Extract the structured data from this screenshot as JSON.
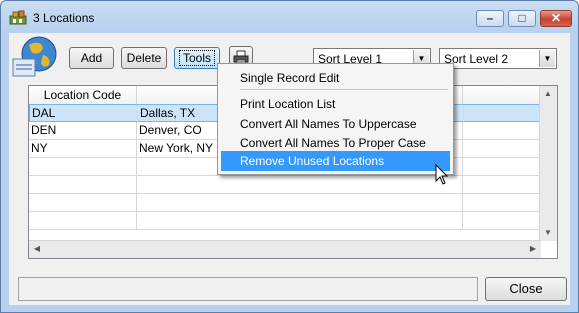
{
  "window": {
    "title": "3 Locations",
    "caption_buttons": {
      "minimize": "–",
      "maximize": "□",
      "close": "✕"
    }
  },
  "toolbar": {
    "add_label": "Add",
    "delete_label": "Delete",
    "tools_label": "Tools",
    "print_icon": "printer-icon",
    "sort_level_1": "Sort Level 1",
    "sort_level_2": "Sort Level 2"
  },
  "grid": {
    "columns": [
      "Location Code",
      "",
      ""
    ],
    "rows": [
      {
        "code": "DAL",
        "name": "Dallas, TX",
        "selected": true
      },
      {
        "code": "DEN",
        "name": "Denver, CO",
        "selected": false
      },
      {
        "code": "NY",
        "name": "New York, NY",
        "selected": false
      }
    ]
  },
  "tools_menu": {
    "items": [
      "Single Record Edit",
      "Print Location List",
      "Convert All Names To Uppercase",
      "Convert All Names To Proper Case",
      "Remove Unused Locations"
    ],
    "highlighted_index": 4
  },
  "footer": {
    "close_label": "Close"
  },
  "colors": {
    "highlight": "#3399ff",
    "selected_row": "#cce4f7",
    "window_frame": "#b9d1ee"
  }
}
